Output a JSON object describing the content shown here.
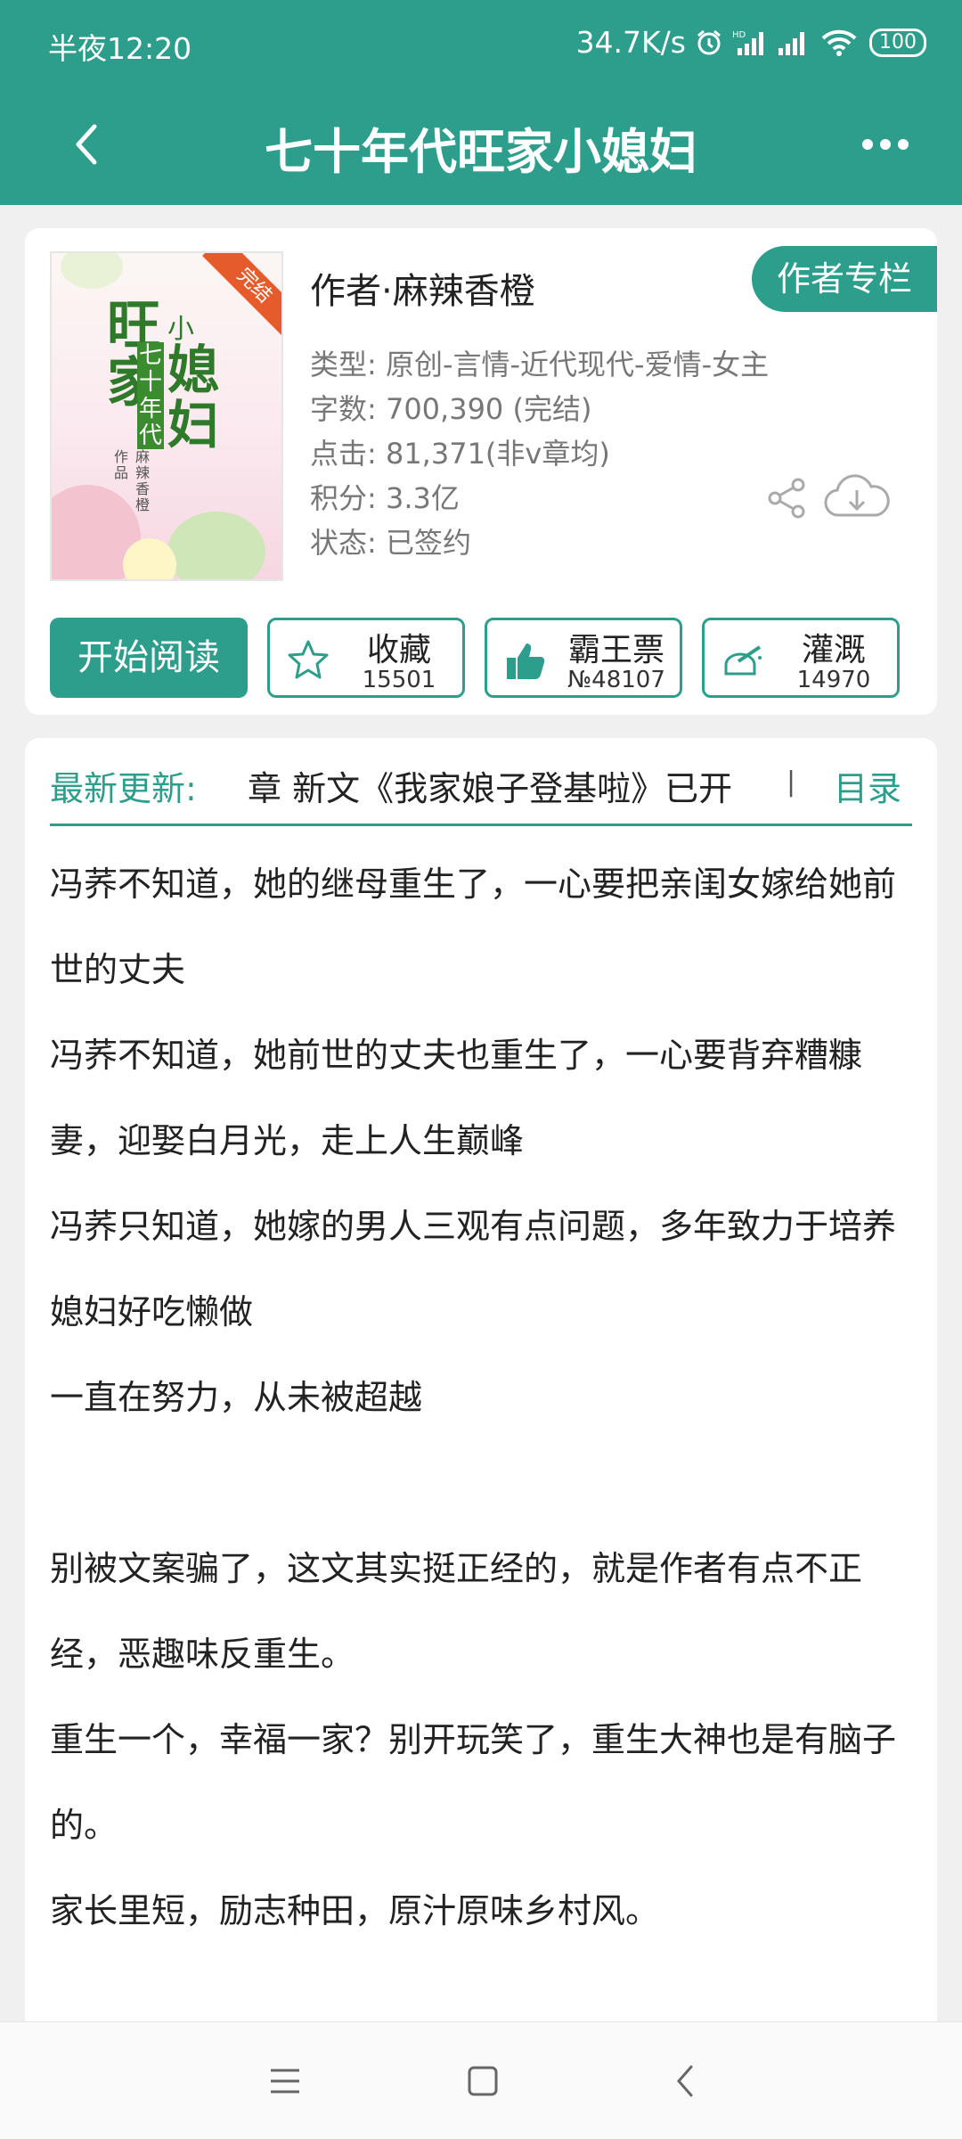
{
  "status_bar": {
    "time": "半夜12:20",
    "net_speed": "34.7K/s",
    "battery": "100"
  },
  "nav": {
    "title": "七十年代旺家小媳妇"
  },
  "book": {
    "cover": {
      "badge": "完结",
      "title_col1": "旺家",
      "title_small": "小",
      "title_col2": "媳妇",
      "title_col3": "七十年代",
      "author": "麻辣香橙",
      "works": "作品"
    },
    "author_line": "作者·麻辣香橙",
    "author_column_button": "作者专栏",
    "meta": {
      "genre": "类型: 原创-言情-近代现代-爱情-女主",
      "words": "字数: 700,390 (完结)",
      "clicks": "点击: 81,371(非v章均)",
      "score": "积分: 3.3亿",
      "state": "状态: 已签约"
    }
  },
  "actions": {
    "read": "开始阅读",
    "favorite": {
      "label": "收藏",
      "count": "15501"
    },
    "vote": {
      "label": "霸王票",
      "count": "№48107"
    },
    "water": {
      "label": "灌溉",
      "count": "14970"
    }
  },
  "update": {
    "label": "最新更新:",
    "text": "章  新文《我家娘子登基啦》已开",
    "toc": "目录"
  },
  "description": [
    "冯荞不知道，她的继母重生了，一心要把亲闺女嫁给她前世的丈夫",
    "冯荞不知道，她前世的丈夫也重生了，一心要背弃糟糠妻，迎娶白月光，走上人生巅峰",
    "冯荞只知道，她嫁的男人三观有点问题，多年致力于培养媳妇好吃懒做",
    "一直在努力，从未被超越",
    "",
    "别被文案骗了，这文其实挺正经的，就是作者有点不正经，恶趣味反重生。",
    "重生一个，幸福一家？别开玩笑了，重生大神也是有脑子的。",
    "家长里短，励志种田，原汁原味乡村风。"
  ],
  "colors": {
    "primary": "#2e9e8c",
    "badge": "#e65b2c"
  }
}
